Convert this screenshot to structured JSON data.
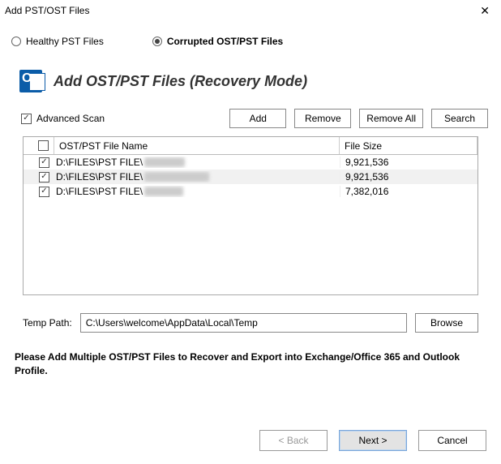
{
  "window": {
    "title": "Add PST/OST Files"
  },
  "radios": {
    "healthy": "Healthy PST Files",
    "corrupted": "Corrupted OST/PST Files",
    "selected": "corrupted"
  },
  "heading": "Add OST/PST Files (Recovery Mode)",
  "advanced_scan_label": "Advanced Scan",
  "buttons": {
    "add": "Add",
    "remove": "Remove",
    "remove_all": "Remove All",
    "search": "Search",
    "browse": "Browse",
    "back": "< Back",
    "next": "Next >",
    "cancel": "Cancel"
  },
  "table": {
    "col_name": "OST/PST File Name",
    "col_size": "File Size",
    "rows": [
      {
        "path": "D:\\FILES\\PST FILE\\",
        "size": "9,921,536"
      },
      {
        "path": "D:\\FILES\\PST FILE\\",
        "size": "9,921,536"
      },
      {
        "path": "D:\\FILES\\PST FILE\\",
        "size": "7,382,016"
      }
    ]
  },
  "temp": {
    "label": "Temp Path:",
    "value": "C:\\Users\\welcome\\AppData\\Local\\Temp"
  },
  "note": "Please Add Multiple OST/PST Files to Recover and Export into Exchange/Office 365 and Outlook Profile."
}
